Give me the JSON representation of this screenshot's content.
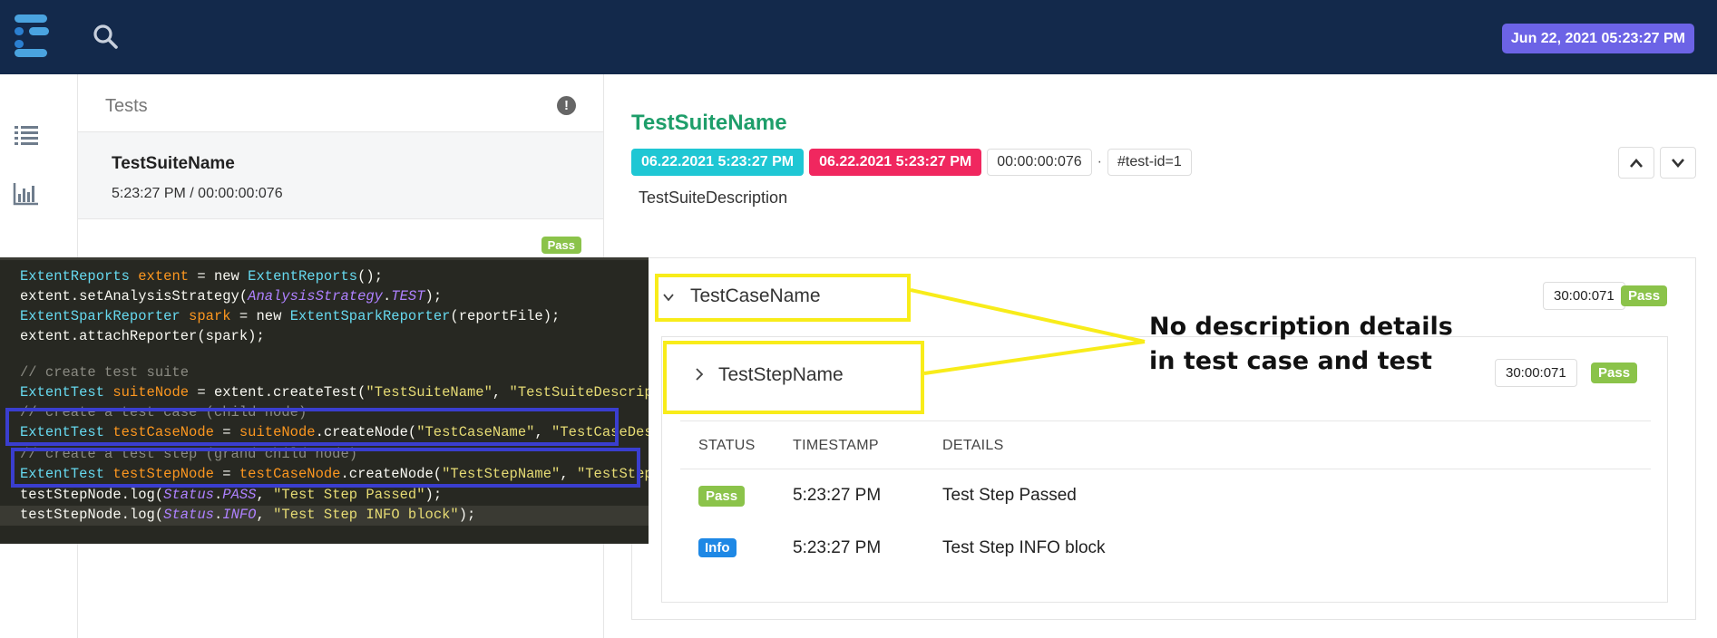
{
  "topbar": {
    "logo_icon": "extent-logo-icon",
    "search_icon": "search-icon",
    "date": "Jun 22, 2021 05:23:27 PM"
  },
  "sidebar": {
    "items": [
      {
        "icon": "list-icon"
      },
      {
        "icon": "bar-chart-icon"
      }
    ]
  },
  "tests_panel": {
    "title": "Tests",
    "alert_icon": "exclamation-icon",
    "alert_glyph": "!",
    "items": [
      {
        "name": "TestSuiteName",
        "meta": "5:23:27 PM / 00:00:00:076",
        "status": "Pass"
      }
    ]
  },
  "detail": {
    "suite_name": "TestSuiteName",
    "start_time": "06.22.2021 5:23:27 PM",
    "end_time": "06.22.2021 5:23:27 PM",
    "duration": "00:00:00:076",
    "separator": "·",
    "test_id": "#test-id=1",
    "description": "TestSuiteDescription",
    "case": {
      "name": "TestCaseName",
      "duration": "30:00:071",
      "status": "Pass",
      "step": {
        "name": "TestStepName",
        "duration": "30:00:071",
        "status": "Pass",
        "columns": [
          "STATUS",
          "TIMESTAMP",
          "DETAILS"
        ],
        "rows": [
          {
            "status": "Pass",
            "timestamp": "5:23:27 PM",
            "details": "Test Step Passed"
          },
          {
            "status": "Info",
            "timestamp": "5:23:27 PM",
            "details": "Test Step INFO block"
          }
        ]
      }
    }
  },
  "code": {
    "lines": [
      "ExtentReports extent = new ExtentReports();",
      "extent.setAnalysisStrategy(AnalysisStrategy.TEST);",
      "ExtentSparkReporter spark = new ExtentSparkReporter(reportFile);",
      "extent.attachReporter(spark);",
      "",
      "// create test suite",
      "ExtentTest suiteNode = extent.createTest(\"TestSuiteName\", \"TestSuiteDescription\");",
      "// create a test case (child node)",
      "ExtentTest testCaseNode = suiteNode.createNode(\"TestCaseName\", \"TestCaseDescription\");",
      "// create a test step (grand child node)",
      "ExtentTest testStepNode = testCaseNode.createNode(\"TestStepName\", \"TestStepDescription\");",
      "testStepNode.log(Status.PASS, \"Test Step Passed\");",
      "testStepNode.log(Status.INFO, \"Test Step INFO block\");"
    ]
  },
  "annotation": {
    "line1": "No description details",
    "line2": "in test case and test"
  },
  "colors": {
    "topbar": "#13294b",
    "accent_green": "#1e9e6a",
    "badge_cyan": "#1fc7d4",
    "badge_red": "#f0275f",
    "pass": "#8bc34a",
    "info": "#1e88e5",
    "highlight_blue": "#3a3ecf",
    "highlight_yellow": "#f8ec1a"
  }
}
